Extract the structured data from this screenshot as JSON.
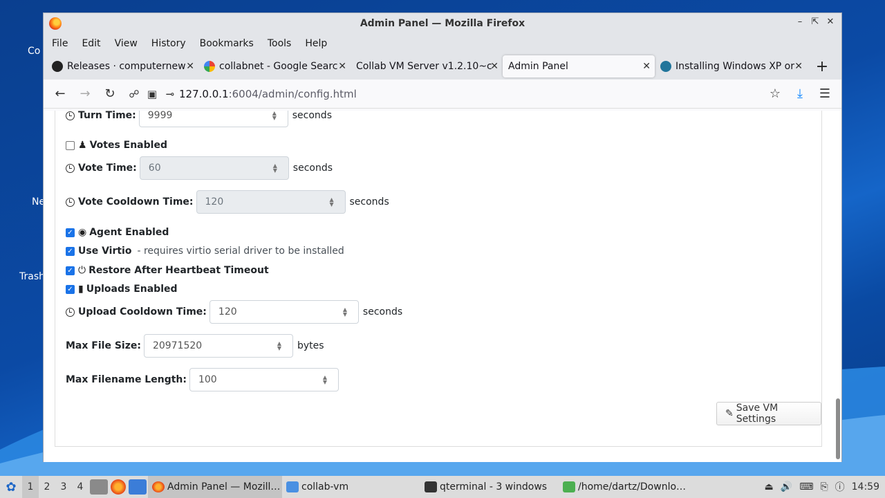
{
  "desktop": {
    "labels": [
      "Co",
      "Ne",
      "Trash"
    ]
  },
  "window": {
    "title": "Admin Panel — Mozilla Firefox"
  },
  "menu": [
    "File",
    "Edit",
    "View",
    "History",
    "Bookmarks",
    "Tools",
    "Help"
  ],
  "tabs": [
    {
      "label": "Releases · computernew",
      "icon": "github-icon",
      "color": "#222222"
    },
    {
      "label": "collabnet - Google Searc",
      "icon": "google-icon",
      "color": "#4285f4"
    },
    {
      "label": "Collab VM Server v1.2.10~c",
      "icon": "none",
      "color": ""
    },
    {
      "label": "Admin Panel",
      "icon": "none",
      "color": "",
      "active": true
    },
    {
      "label": "Installing Windows XP or",
      "icon": "wordpress-icon",
      "color": "#21759b"
    }
  ],
  "url": {
    "host": "127.0.0.1",
    "path": ":6004/admin/config.html"
  },
  "form": {
    "turn_time": {
      "label": "Turn Time:",
      "value": "9999",
      "unit": "seconds"
    },
    "votes_enabled": {
      "label": "Votes Enabled",
      "checked": false
    },
    "vote_time": {
      "label": "Vote Time:",
      "value": "60",
      "unit": "seconds"
    },
    "vote_cooldown": {
      "label": "Vote Cooldown Time:",
      "value": "120",
      "unit": "seconds"
    },
    "agent_enabled": {
      "label": "Agent Enabled",
      "checked": true
    },
    "use_virtio": {
      "label": "Use Virtio",
      "note": "- requires virtio serial driver to be installed",
      "checked": true
    },
    "restore_heartbeat": {
      "label": "Restore After Heartbeat Timeout",
      "checked": true
    },
    "uploads_enabled": {
      "label": "Uploads Enabled",
      "checked": true
    },
    "upload_cooldown": {
      "label": "Upload Cooldown Time:",
      "value": "120",
      "unit": "seconds"
    },
    "max_file_size": {
      "label": "Max File Size:",
      "value": "20971520",
      "unit": "bytes"
    },
    "max_filename_length": {
      "label": "Max Filename Length:",
      "value": "100"
    },
    "save_label": "Save VM Settings"
  },
  "taskbar": {
    "workspaces": [
      "1",
      "2",
      "3",
      "4"
    ],
    "tasks": [
      {
        "label": "Admin Panel — Mozill…",
        "active": true
      },
      {
        "label": "collab-vm",
        "active": false
      },
      {
        "label": "qterminal - 3 windows",
        "active": false
      },
      {
        "label": "/home/dartz/Downlo…",
        "active": false
      }
    ],
    "clock": "14:59"
  }
}
